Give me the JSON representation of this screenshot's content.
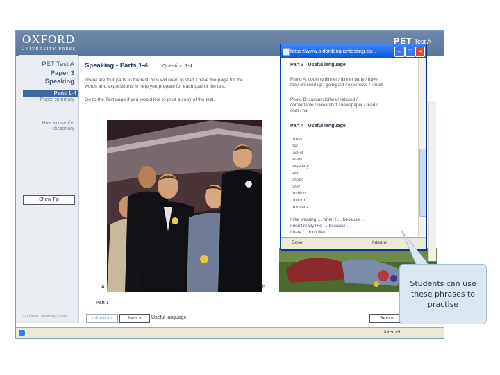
{
  "app": {
    "logo_line1": "OXFORD",
    "logo_line2": "UNIVERSITY PRESS",
    "brand": "PET",
    "brand_suffix": "Test A"
  },
  "nav": {
    "test": "PET Test A",
    "paper": "Paper 3",
    "section": "Speaking",
    "active_item": "Parts 1-4",
    "link_paper_summary": "Paper summary",
    "link_how_to_line1": "How to use the",
    "link_how_to_line2": "dictionary",
    "show_tip": "Show Tip",
    "copyright": "© Oxford University Press"
  },
  "content": {
    "heading": "Speaking • Parts 1-4",
    "question": "Question 1-4",
    "para1_line1": "There are four parts to the test. You will need to start I have the page for the",
    "para1_line2": "words and expressions to help you prepare for each part of the test.",
    "para2": "Go to the Test page if you would like to print a copy of the test.",
    "label_a": "A",
    "label_n": "n",
    "part_label": "Part 1",
    "prev_button": "< Previous",
    "next_button": "Next >",
    "useful_link": "Useful language",
    "return_button": "Return"
  },
  "statusbar": {
    "zone": "Internet"
  },
  "popup": {
    "title": "https://www.oxfordenglishtesting.co...",
    "heading_part3": "Part 3 - Useful language",
    "photo_a_line1": "Photo A: cooking dinner / dinner party / have",
    "photo_a_line2": "tea / dressed up / going out / expensive / smart",
    "photo_b_line1": "Photo B: casual clothes / relaxed /",
    "photo_b_line2": "comfortable / sweatshirt / newspaper / read /",
    "photo_b_line3": "chat / hat",
    "heading_part4": "Part 4 - Useful language",
    "words": [
      "dress",
      "hat",
      "jacket",
      "jeans",
      "jewellery",
      "skirt",
      "shoes",
      "shirt",
      "fashion",
      "uniform",
      "trousers"
    ],
    "phrase1": "I like wearing … when I … because …",
    "phrase2": "I don't really like … because …",
    "phrase3": "I hate / I don't like …",
    "status_done": "Done",
    "status_zone": "Internet"
  },
  "callout": {
    "line1": "Students can use",
    "line2": "these phrases to",
    "line3": "practise"
  },
  "colors": {
    "banner": "#5f7b9e",
    "nav_active": "#3e6aa1",
    "popup_title": "#0b54d9",
    "callout_bg": "#dbe6f1"
  }
}
